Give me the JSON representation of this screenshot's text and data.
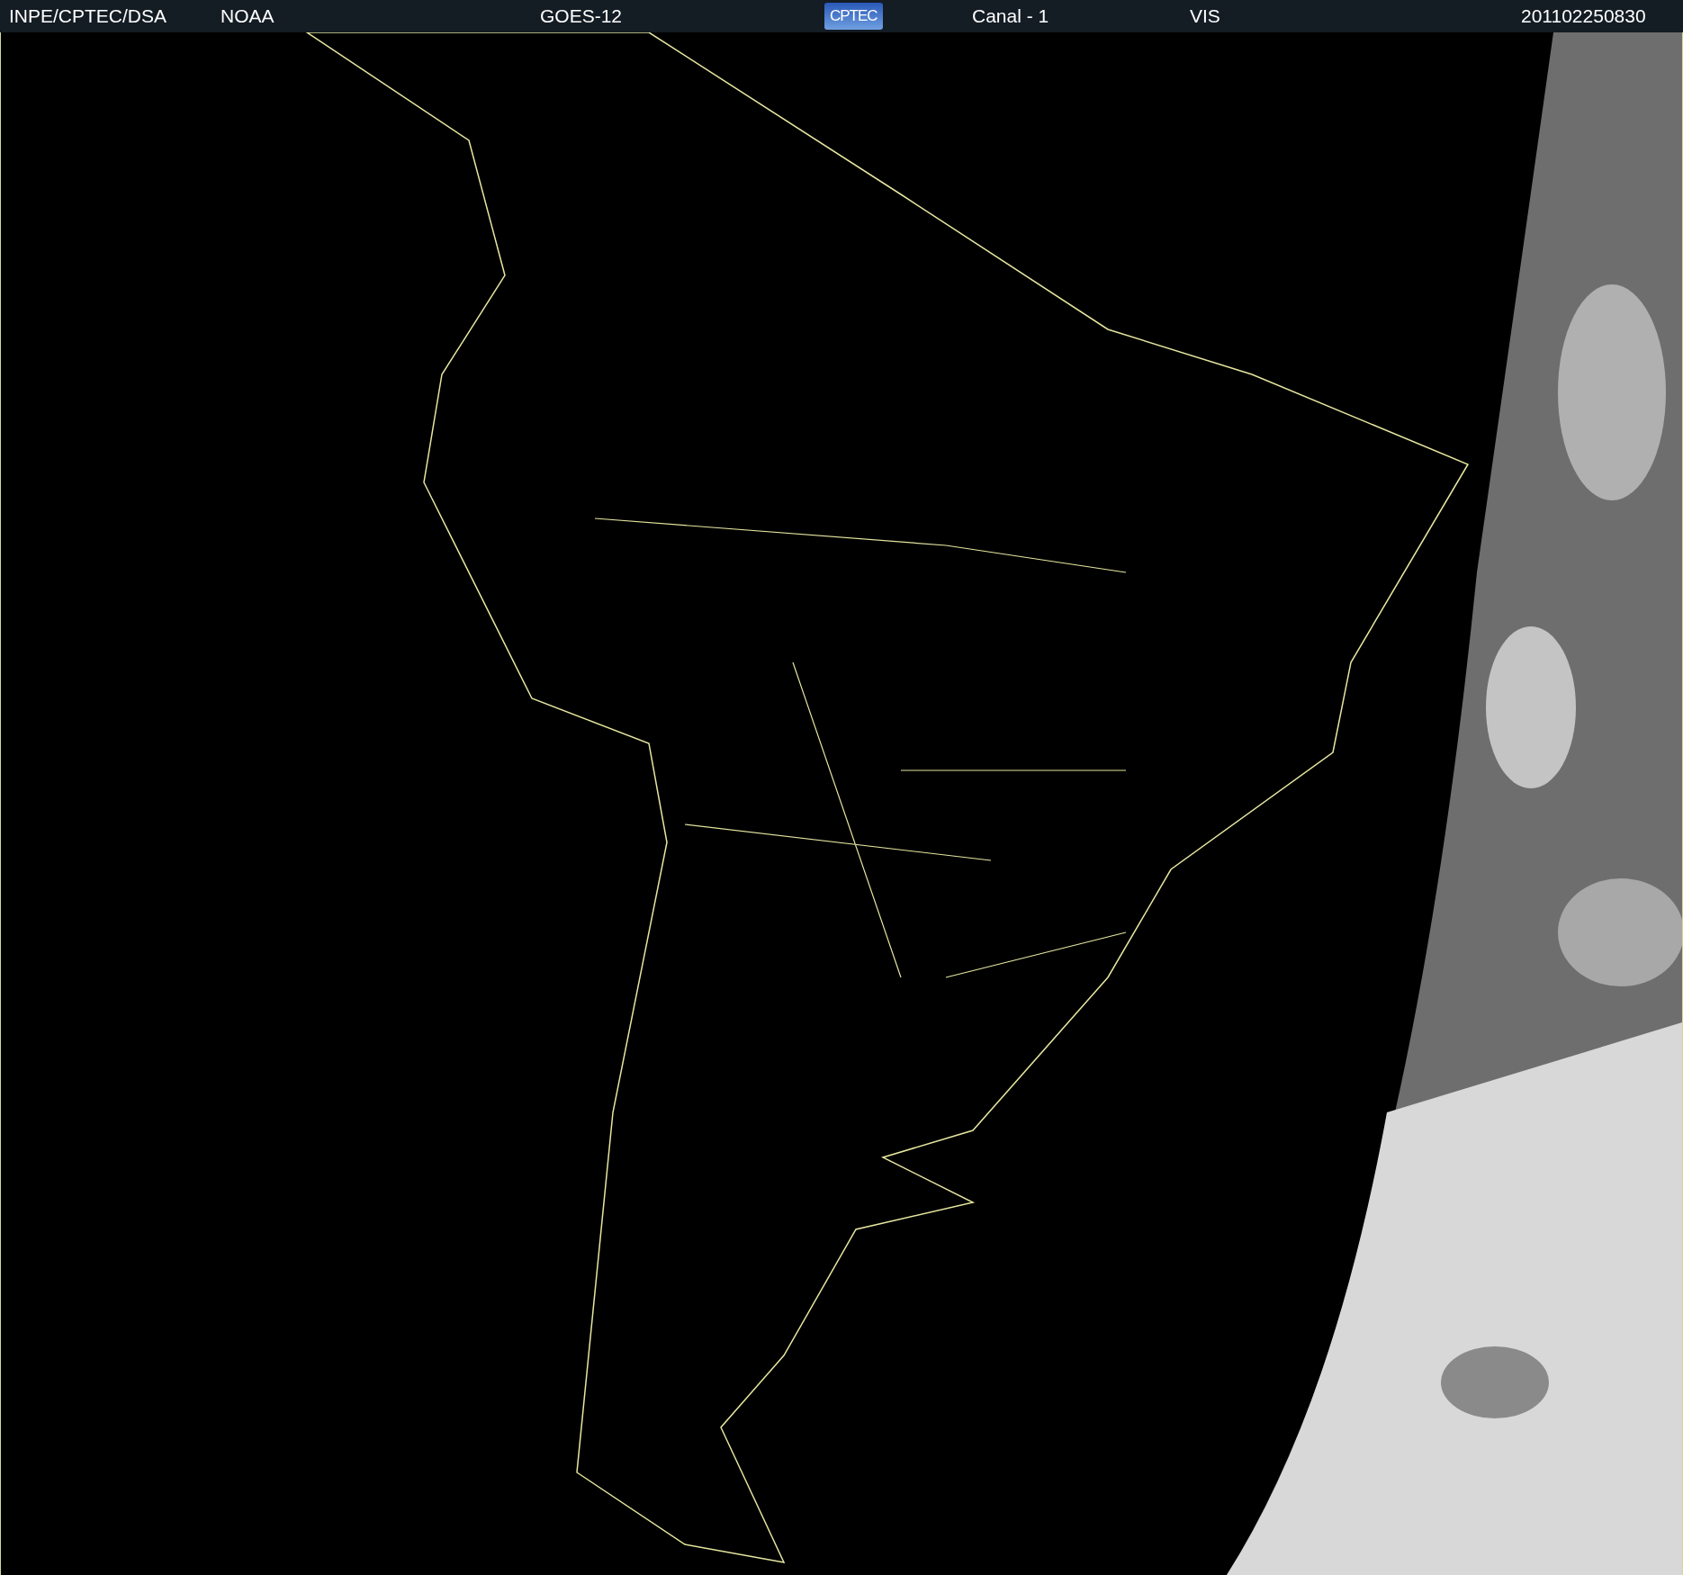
{
  "header": {
    "source": "INPE/CPTEC/DSA",
    "agency": "NOAA",
    "satellite": "GOES-12",
    "logo": "CPTEC",
    "channel": "Canal - 1",
    "band": "VIS",
    "timestamp": "201102250830"
  }
}
